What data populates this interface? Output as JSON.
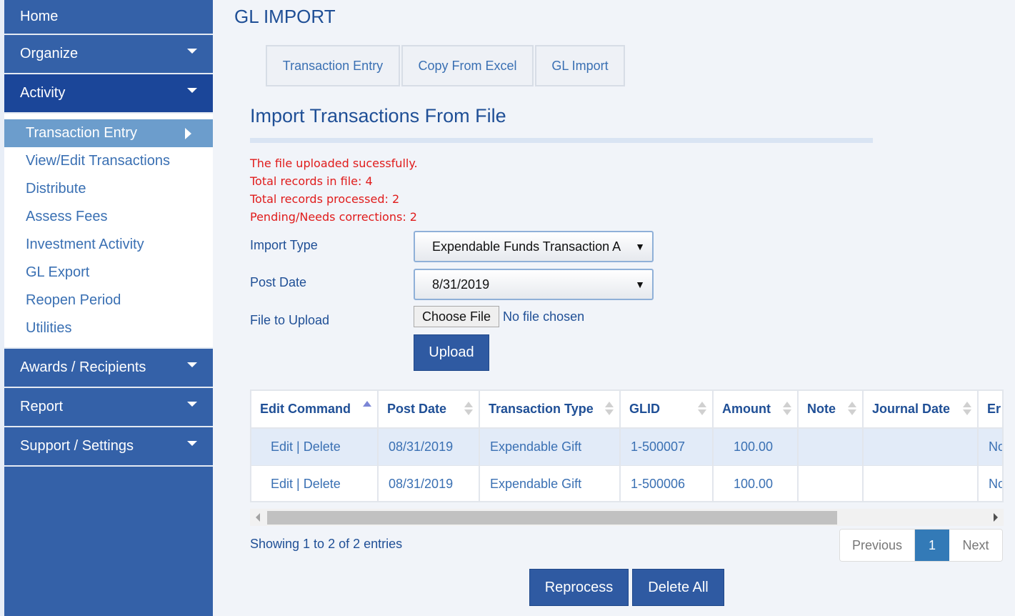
{
  "sidebar": {
    "home": "Home",
    "organize": "Organize",
    "activity": "Activity",
    "activity_items": [
      "Transaction Entry",
      "View/Edit Transactions",
      "Distribute",
      "Assess Fees",
      "Investment Activity",
      "GL Export",
      "Reopen Period",
      "Utilities"
    ],
    "awards": "Awards / Recipients",
    "report": "Report",
    "support": "Support / Settings"
  },
  "page": {
    "title": "GL IMPORT",
    "tabs": [
      "Transaction Entry",
      "Copy From Excel",
      "GL Import"
    ],
    "section_title": "Import Transactions From File"
  },
  "messages": [
    "The file uploaded sucessfully.",
    "Total records in file: 4",
    "Total records processed: 2",
    "Pending/Needs corrections: 2"
  ],
  "form": {
    "import_type_label": "Import Type",
    "import_type_value": "Expendable Funds Transaction A",
    "post_date_label": "Post Date",
    "post_date_value": "8/31/2019",
    "file_label": "File to Upload",
    "choose_file": "Choose File",
    "no_file": "No file chosen",
    "upload": "Upload"
  },
  "table": {
    "columns": [
      "Edit Command",
      "Post Date",
      "Transaction Type",
      "GLID",
      "Amount",
      "Note",
      "Journal Date",
      "Er"
    ],
    "rows": [
      {
        "edit": "Edit",
        "sep": "|",
        "delete": "Delete",
        "post_date": "08/31/2019",
        "type": "Expendable Gift",
        "glid": "1-500007",
        "amount": "100.00",
        "note": "",
        "journal_date": "",
        "er": "No"
      },
      {
        "edit": "Edit",
        "sep": "|",
        "delete": "Delete",
        "post_date": "08/31/2019",
        "type": "Expendable Gift",
        "glid": "1-500006",
        "amount": "100.00",
        "note": "",
        "journal_date": "",
        "er": "No"
      }
    ]
  },
  "footer": {
    "showing": "Showing 1 to 2 of 2 entries",
    "previous": "Previous",
    "page": "1",
    "next": "Next",
    "reprocess": "Reprocess",
    "delete_all": "Delete All"
  }
}
